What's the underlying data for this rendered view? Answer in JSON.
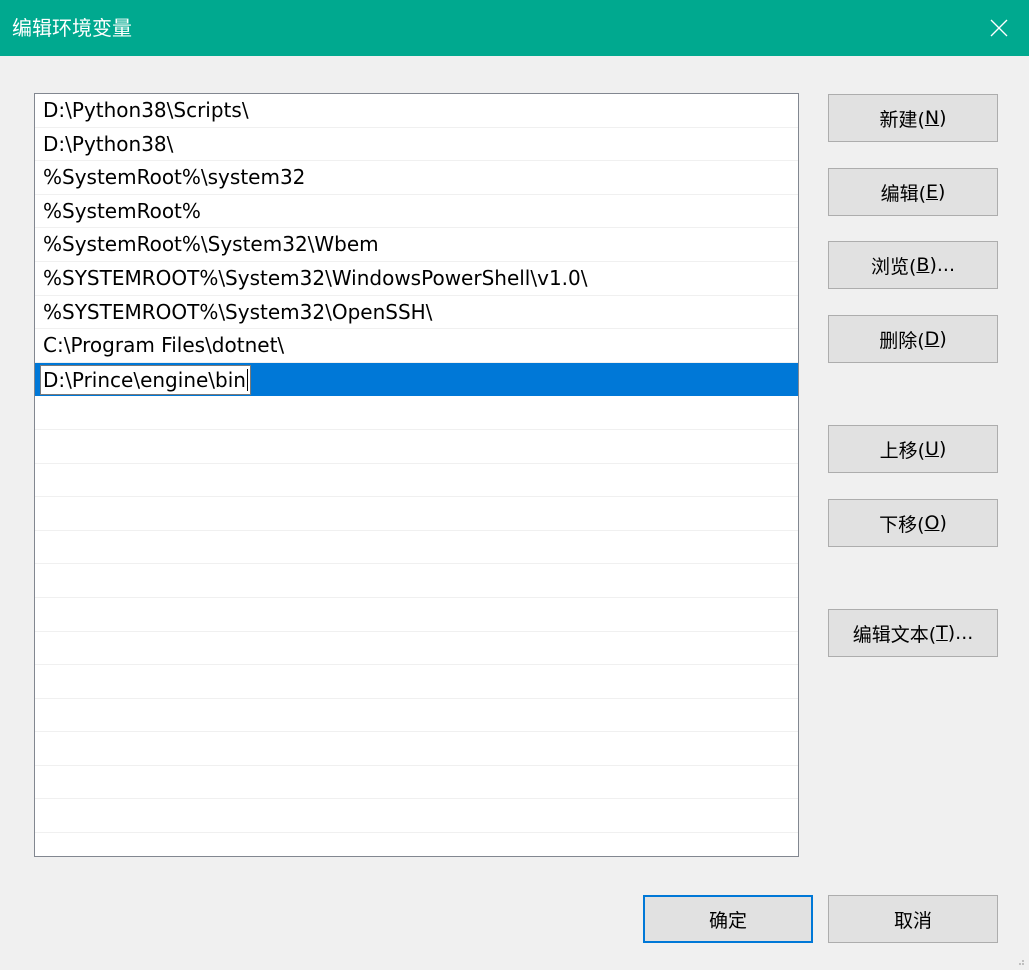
{
  "window": {
    "title": "编辑环境变量",
    "close_glyph": "✕",
    "titlebar_color": "#00a98f"
  },
  "list": {
    "items": [
      "D:\\Python38\\Scripts\\",
      "D:\\Python38\\",
      "%SystemRoot%\\system32",
      "%SystemRoot%",
      "%SystemRoot%\\System32\\Wbem",
      "%SYSTEMROOT%\\System32\\WindowsPowerShell\\v1.0\\",
      "%SYSTEMROOT%\\System32\\OpenSSH\\",
      "C:\\Program Files\\dotnet\\"
    ],
    "editing_value": "D:\\Prince\\engine\\bin",
    "selection_color": "#0078d7"
  },
  "buttons": {
    "new": {
      "text": "新建(",
      "key": "N",
      "suffix": ")"
    },
    "edit": {
      "text": "编辑(",
      "key": "E",
      "suffix": ")"
    },
    "browse": {
      "text": "浏览(",
      "key": "B",
      "suffix": ")..."
    },
    "delete": {
      "text": "删除(",
      "key": "D",
      "suffix": ")"
    },
    "move_up": {
      "text": "上移(",
      "key": "U",
      "suffix": ")"
    },
    "move_down": {
      "text": "下移(",
      "key": "O",
      "suffix": ")"
    },
    "edit_text": {
      "text": "编辑文本(",
      "key": "T",
      "suffix": ")..."
    },
    "ok": "确定",
    "cancel": "取消"
  }
}
